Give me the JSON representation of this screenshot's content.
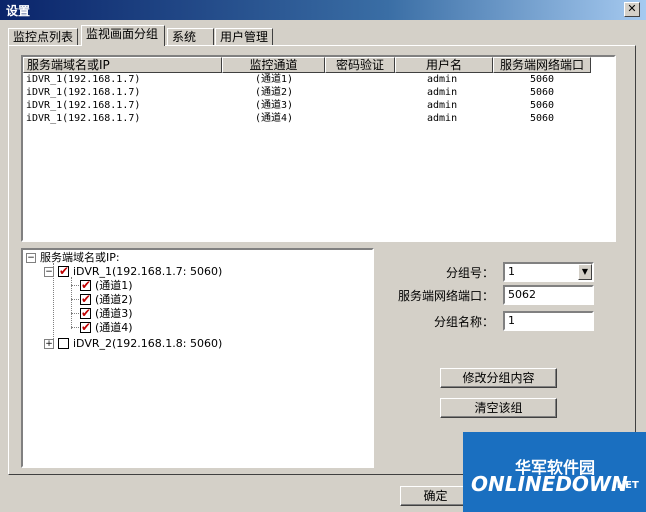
{
  "window": {
    "title": "设置",
    "close_glyph": "✕"
  },
  "tabs": [
    "监控点列表",
    "监视画面分组",
    "系统",
    "用户管理"
  ],
  "list": {
    "headers": [
      "服务端域名或IP",
      "监控通道",
      "密码验证",
      "用户名",
      "服务端网络端口"
    ],
    "rows": [
      [
        "iDVR_1(192.168.1.7)",
        "(通道1)",
        "",
        "admin",
        "5060"
      ],
      [
        "iDVR_1(192.168.1.7)",
        "(通道2)",
        "",
        "admin",
        "5060"
      ],
      [
        "iDVR_1(192.168.1.7)",
        "(通道3)",
        "",
        "admin",
        "5060"
      ],
      [
        "iDVR_1(192.168.1.7)",
        "(通道4)",
        "",
        "admin",
        "5060"
      ]
    ]
  },
  "tree": {
    "root": "服务端域名或IP:",
    "dvr1": "iDVR_1(192.168.1.7: 5060)",
    "channels": [
      "(通道1)",
      "(通道2)",
      "(通道3)",
      "(通道4)"
    ],
    "dvr2": "iDVR_2(192.168.1.8: 5060)"
  },
  "form": {
    "group_no_label": "分组号：",
    "group_no_value": "1",
    "port_label": "服务端网络端口：",
    "port_value": "5062",
    "group_name_label": "分组名称：",
    "group_name_value": "1"
  },
  "buttons": {
    "modify": "修改分组内容",
    "clear": "清空该组",
    "ok": "确定"
  },
  "watermark": {
    "text1": "华军软件园",
    "text2": "ONLINEDOWN",
    "text3": ".NET"
  }
}
